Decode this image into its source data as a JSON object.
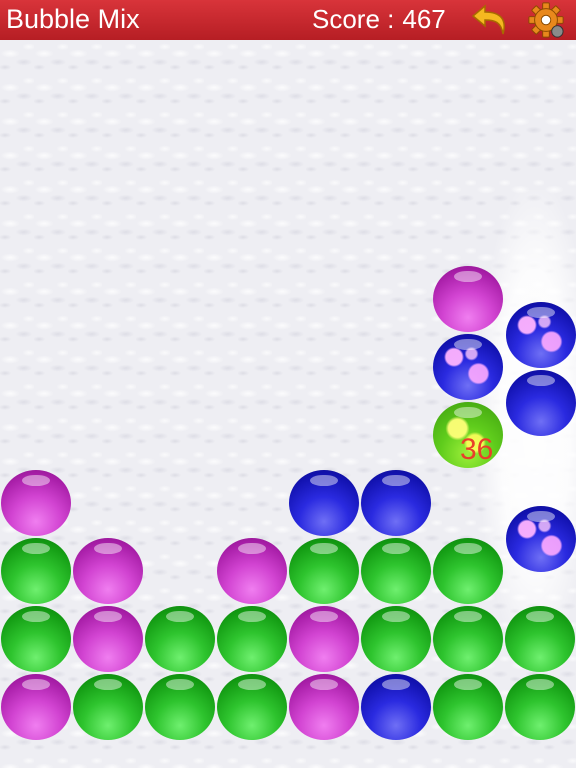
{
  "header": {
    "title": "Bubble Mix",
    "score_label": "Score :",
    "score_value": "467",
    "undo_icon": "undo-arrow-icon",
    "settings_icon": "gear-icon"
  },
  "board": {
    "floating_points": "36",
    "colors": {
      "header": "#c4262c",
      "green": "#1faa1f",
      "purple": "#c030c0",
      "blue": "#1e1ed2",
      "yellow": "#c8e81c"
    },
    "bubbles": [
      {
        "color": "purple",
        "col": 6,
        "row": 0,
        "offset": false
      },
      {
        "color": "blue-sparkle",
        "col": 7,
        "row": 0,
        "offset": true
      },
      {
        "color": "blue-sparkle",
        "col": 6,
        "row": 1,
        "offset": false
      },
      {
        "color": "blue",
        "col": 7,
        "row": 1,
        "offset": true
      },
      {
        "color": "yellow",
        "col": 6,
        "row": 2,
        "offset": false
      },
      {
        "color": "purple",
        "col": 0,
        "row": 3,
        "offset": false
      },
      {
        "color": "blue",
        "col": 4,
        "row": 3,
        "offset": false
      },
      {
        "color": "blue",
        "col": 5,
        "row": 3,
        "offset": false
      },
      {
        "color": "blue-sparkle",
        "col": 7,
        "row": 3,
        "offset": true
      },
      {
        "color": "green",
        "col": 0,
        "row": 4,
        "offset": false
      },
      {
        "color": "purple",
        "col": 1,
        "row": 4,
        "offset": false
      },
      {
        "color": "purple",
        "col": 3,
        "row": 4,
        "offset": false
      },
      {
        "color": "green",
        "col": 4,
        "row": 4,
        "offset": false
      },
      {
        "color": "green",
        "col": 5,
        "row": 4,
        "offset": false
      },
      {
        "color": "green",
        "col": 6,
        "row": 4,
        "offset": false
      },
      {
        "color": "green",
        "col": 0,
        "row": 5,
        "offset": false
      },
      {
        "color": "purple",
        "col": 1,
        "row": 5,
        "offset": false
      },
      {
        "color": "green",
        "col": 2,
        "row": 5,
        "offset": false
      },
      {
        "color": "green",
        "col": 3,
        "row": 5,
        "offset": false
      },
      {
        "color": "purple",
        "col": 4,
        "row": 5,
        "offset": false
      },
      {
        "color": "green",
        "col": 5,
        "row": 5,
        "offset": false
      },
      {
        "color": "green",
        "col": 6,
        "row": 5,
        "offset": false
      },
      {
        "color": "green",
        "col": 7,
        "row": 5,
        "offset": false
      },
      {
        "color": "purple",
        "col": 0,
        "row": 6,
        "offset": false
      },
      {
        "color": "green",
        "col": 1,
        "row": 6,
        "offset": false
      },
      {
        "color": "green",
        "col": 2,
        "row": 6,
        "offset": false
      },
      {
        "color": "green",
        "col": 3,
        "row": 6,
        "offset": false
      },
      {
        "color": "purple",
        "col": 4,
        "row": 6,
        "offset": false
      },
      {
        "color": "blue",
        "col": 5,
        "row": 6,
        "offset": false
      },
      {
        "color": "green",
        "col": 6,
        "row": 6,
        "offset": false
      },
      {
        "color": "green",
        "col": 7,
        "row": 6,
        "offset": false
      }
    ]
  }
}
